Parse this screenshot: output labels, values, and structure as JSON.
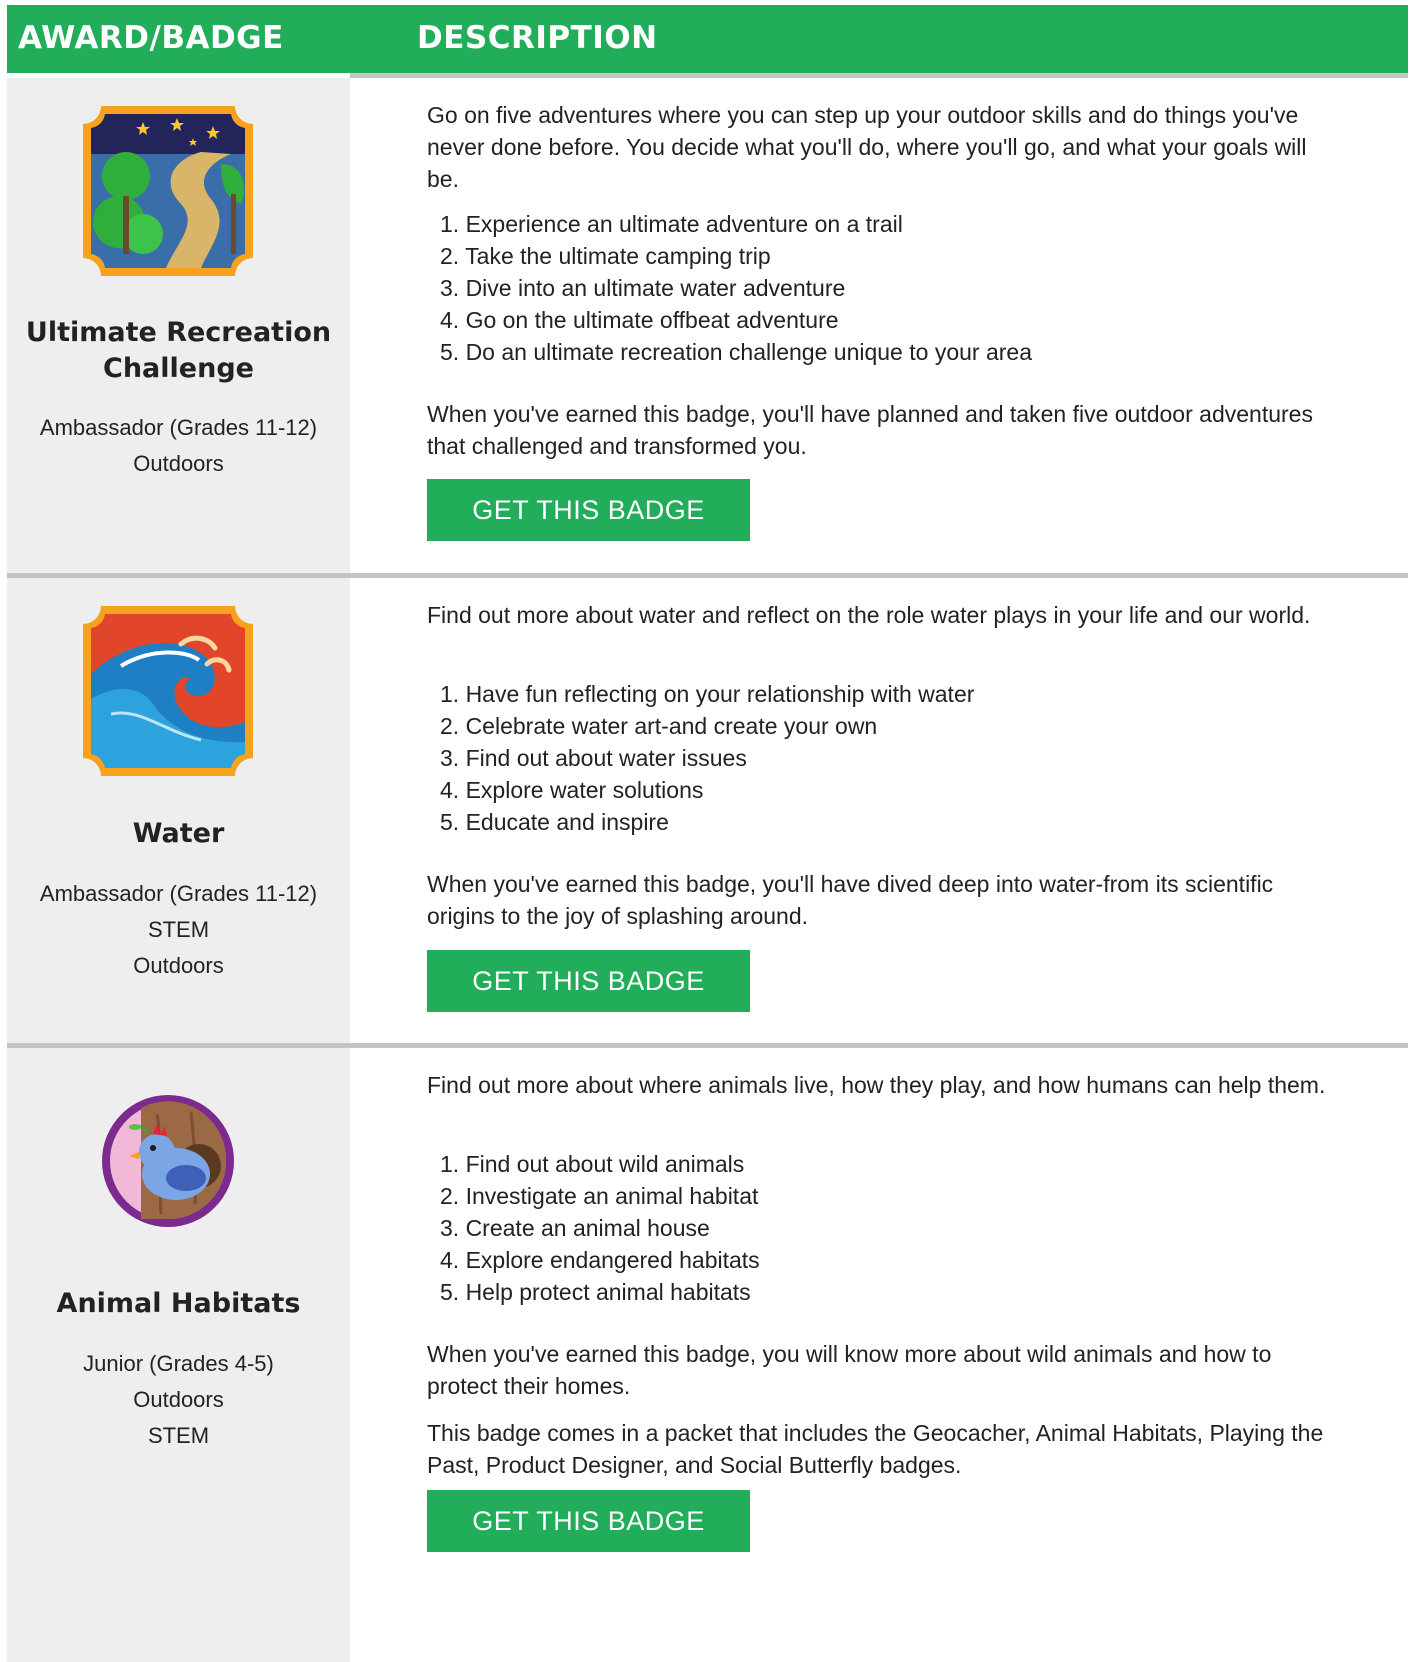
{
  "header": {
    "award_label": "AWARD/BADGE",
    "description_label": "DESCRIPTION"
  },
  "colors": {
    "brand_green": "#22ad5a",
    "left_panel": "#eeeeee",
    "divider": "#c4c4c4"
  },
  "badges": [
    {
      "title_line1": "Ultimate Recreation",
      "title_line2": "Challenge",
      "meta": [
        "Ambassador (Grades 11-12)",
        "Outdoors"
      ],
      "icon": "trail-stars-badge-icon",
      "intro_line1": "Go on five adventures where you can step up your outdoor skills and do things you've",
      "intro_line2": "never done before. You decide what you'll do, where you'll go, and what your goals will",
      "intro_line3": "be.",
      "steps": [
        "1. Experience an ultimate adventure on a trail",
        "2. Take the ultimate camping trip",
        "3. Dive into an ultimate water adventure",
        "4. Go on the ultimate offbeat adventure",
        "5. Do an ultimate recreation challenge unique to your area"
      ],
      "outcome_line1": "When you've earned this badge, you'll have planned and taken five outdoor adventures",
      "outcome_line2": "that challenged and transformed you.",
      "button": "GET THIS BADGE"
    },
    {
      "title_line1": "Water",
      "meta": [
        "Ambassador (Grades 11-12)",
        "STEM",
        "Outdoors"
      ],
      "icon": "wave-badge-icon",
      "intro_line1": "Find out more about water and reflect on the role water plays in your life and our world.",
      "steps": [
        "1. Have fun reflecting on your relationship with water",
        "2. Celebrate water art-and create your own",
        "3. Find out about water issues",
        "4. Explore water solutions",
        "5. Educate and inspire"
      ],
      "outcome_line1": "When you've earned this badge, you'll have dived deep into water-from its scientific",
      "outcome_line2": "origins to the joy of splashing around.",
      "button": "GET THIS BADGE"
    },
    {
      "title_line1": "Animal Habitats",
      "meta": [
        "Junior (Grades 4-5)",
        "Outdoors",
        "STEM"
      ],
      "icon": "bird-badge-icon",
      "intro_line1": "Find out more about where animals live, how they play, and how humans can help them.",
      "steps": [
        "1. Find out about wild animals",
        "2. Investigate an animal habitat",
        "3. Create an animal house",
        "4. Explore endangered habitats",
        "5. Help protect animal habitats"
      ],
      "outcome_line1": "When you've earned this badge, you will know more about wild animals and how to",
      "outcome_line2": "protect their homes.",
      "note_line1": "This badge comes in a packet that includes the Geocacher, Animal Habitats, Playing the",
      "note_line2": "Past, Product Designer, and Social Butterfly badges.",
      "button": "GET THIS BADGE"
    }
  ]
}
